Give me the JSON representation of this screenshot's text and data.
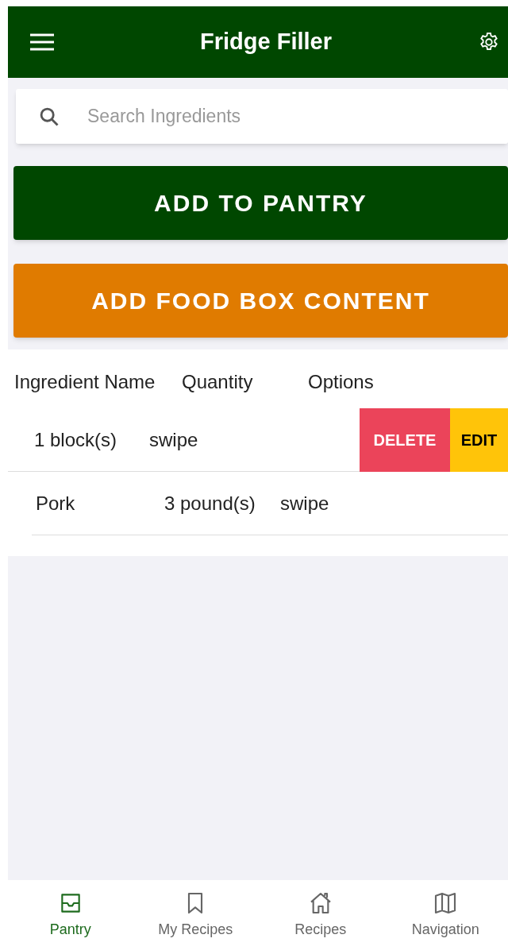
{
  "app_bar": {
    "title": "Fridge Filler"
  },
  "search": {
    "placeholder": "Search Ingredients"
  },
  "buttons": [
    {
      "kind": "primary",
      "label": "ADD TO PANTRY"
    },
    {
      "kind": "secondary",
      "label": "ADD FOOD BOX CONTENT"
    }
  ],
  "table": {
    "columns": [
      "Ingredient Name",
      "Quantity",
      "Options"
    ],
    "rows": [
      {
        "swiped": true,
        "cells": [
          "1 block(s)",
          "swipe"
        ],
        "actions": [
          {
            "kind": "delete",
            "label": "DELETE"
          },
          {
            "kind": "edit",
            "label": "EDIT"
          }
        ]
      },
      {
        "swiped": false,
        "cells": [
          "Pork",
          "3 pound(s)",
          "swipe"
        ]
      }
    ]
  },
  "bottom_nav": [
    {
      "kind": "inbox",
      "label": "Pantry",
      "selected": true
    },
    {
      "kind": "bookmark",
      "label": "My Recipes",
      "selected": false
    },
    {
      "kind": "home",
      "label": "Recipes",
      "selected": false
    },
    {
      "kind": "map",
      "label": "Navigation",
      "selected": false
    }
  ]
}
